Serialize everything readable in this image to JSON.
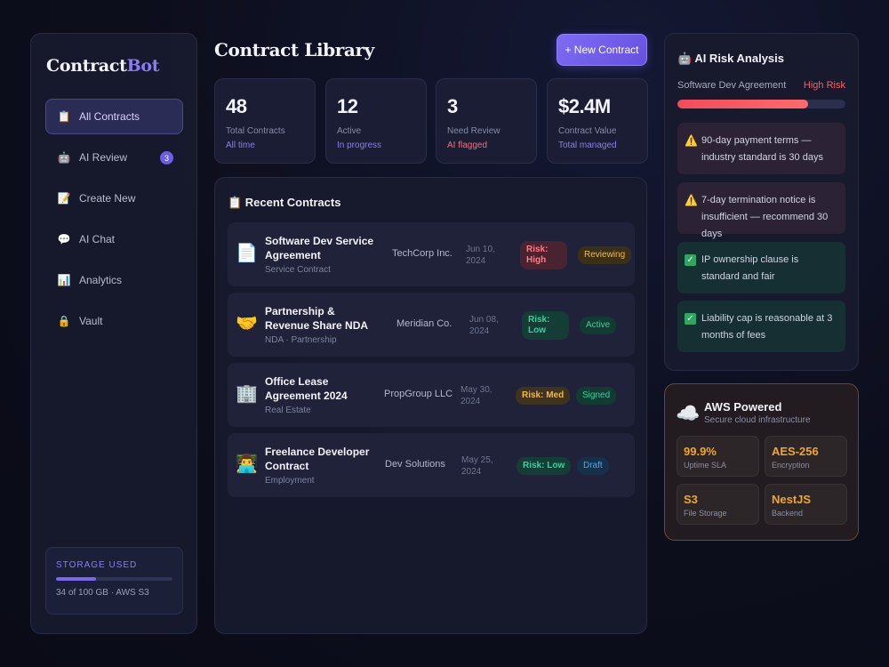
{
  "logo": {
    "main": "Contract",
    "accent": "Bot"
  },
  "sidebar": {
    "items": [
      {
        "label": "All Contracts",
        "icon": "📋",
        "active": true
      },
      {
        "label": "AI Review",
        "icon": "🤖",
        "badge": "3"
      },
      {
        "label": "Create New",
        "icon": "📝"
      },
      {
        "label": "AI Chat",
        "icon": "💬"
      },
      {
        "label": "Analytics",
        "icon": "📊"
      },
      {
        "label": "Vault",
        "icon": "🔒"
      }
    ],
    "storage": {
      "title": "Storage Used",
      "text": "34 of 100 GB · AWS S3",
      "fraction": 0.34,
      "color": "#7a68f0"
    }
  },
  "header": {
    "title": "Contract Library",
    "new_button": "+ New Contract"
  },
  "stats": [
    {
      "value": "48",
      "label": "Total Contracts",
      "sub": "All time",
      "sub_color": "#8b7cf6"
    },
    {
      "value": "12",
      "label": "Active",
      "sub": "In progress",
      "sub_color": "#8b7cf6"
    },
    {
      "value": "3",
      "label": "Need Review",
      "sub": "AI flagged",
      "sub_color": "#ff6b78"
    },
    {
      "value": "$2.4M",
      "label": "Contract Value",
      "sub": "Total managed",
      "sub_color": "#8b7cf6"
    }
  ],
  "recent": {
    "title": "📋 Recent Contracts",
    "rows": [
      {
        "icon": "📄",
        "name": "Software Dev Service Agreement",
        "type": "Service Contract",
        "company": "TechCorp Inc.",
        "date": "Jun 10, 2024",
        "risk": "Risk: High",
        "status": "Reviewing"
      },
      {
        "icon": "🤝",
        "name": "Partnership & Revenue Share NDA",
        "type": "NDA · Partnership",
        "company": "Meridian Co.",
        "date": "Jun 08, 2024",
        "risk": "Risk: Low",
        "status": "Active"
      },
      {
        "icon": "🏢",
        "name": "Office Lease Agreement 2024",
        "type": "Real Estate",
        "company": "PropGroup LLC",
        "date": "May 30, 2024",
        "risk": "Risk: Med",
        "status": "Signed"
      },
      {
        "icon": "👨‍💻",
        "name": "Freelance Developer Contract",
        "type": "Employment",
        "company": "Dev Solutions",
        "date": "May 25, 2024",
        "risk": "Risk: Low",
        "status": "Draft"
      }
    ]
  },
  "ai_risk": {
    "title": "🤖 AI Risk Analysis",
    "document": "Software Dev Agreement",
    "level": "High Risk",
    "level_fraction": 0.78,
    "findings": [
      {
        "icon": "⚠️",
        "kind": "warn",
        "text": "90-day payment terms — industry standard is 30 days"
      },
      {
        "icon": "⚠️",
        "kind": "warn",
        "text": "7-day termination notice is insufficient — recommend 30 days"
      },
      {
        "icon": "✓",
        "kind": "ok",
        "text": "IP ownership clause is standard and fair"
      },
      {
        "icon": "✓",
        "kind": "ok",
        "text": "Liability cap is reasonable at 3 months of fees"
      }
    ]
  },
  "aws": {
    "icon": "☁️",
    "title": "AWS Powered",
    "subtitle": "Secure cloud infrastructure",
    "cells": [
      {
        "value": "99.9%",
        "label": "Uptime SLA"
      },
      {
        "value": "AES-256",
        "label": "Encryption"
      },
      {
        "value": "S3",
        "label": "File Storage"
      },
      {
        "value": "NestJS",
        "label": "Backend"
      }
    ]
  }
}
